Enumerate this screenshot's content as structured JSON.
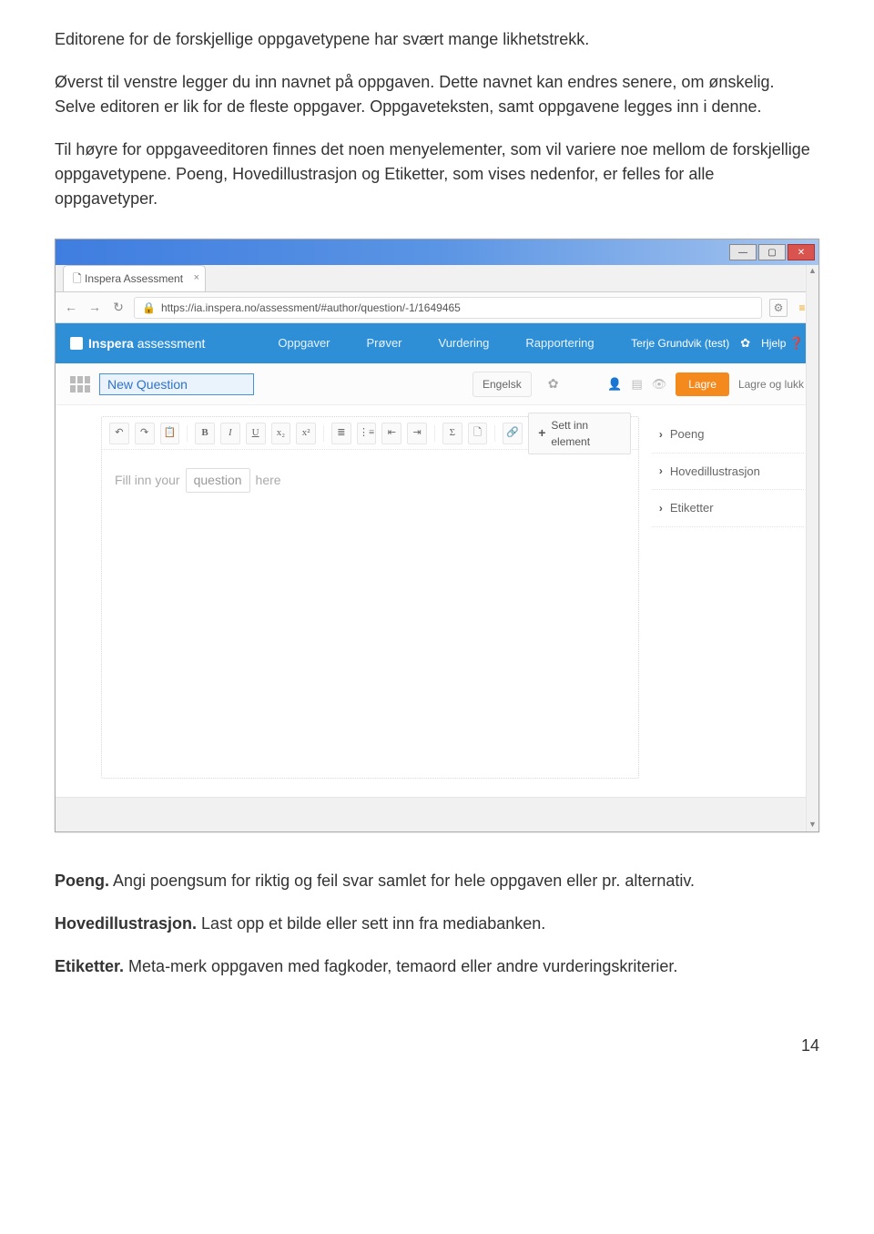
{
  "document": {
    "para1": "Editorene for de forskjellige oppgavetypene har svært mange likhetstrekk.",
    "para2": "Øverst til venstre legger du inn navnet på oppgaven. Dette navnet kan endres senere, om ønskelig. Selve editoren er lik for de fleste oppgaver. Oppgaveteksten, samt oppgavene legges inn i denne.",
    "para3": "Til høyre for oppgaveeditoren finnes det noen menyelementer, som vil variere noe mellom de forskjellige oppgavetypene. Poeng, Hovedillustrasjon og Etiketter, som vises nedenfor, er felles for alle oppgavetyper.",
    "poeng_lead": "Poeng.",
    "poeng_rest": " Angi poengsum for riktig og feil svar samlet for hele oppgaven eller pr. alternativ.",
    "hoved_lead": "Hovedillustrasjon.",
    "hoved_rest": " Last opp et bilde eller sett inn fra mediabanken.",
    "etik_lead": "Etiketter.",
    "etik_rest": " Meta-merk oppgaven med fagkoder, temaord eller andre vurderingskriterier.",
    "page_number": "14"
  },
  "browser": {
    "tab_title": "Inspera Assessment",
    "url": "https://ia.inspera.no/assessment/#author/question/-1/1649465"
  },
  "app": {
    "logo_bold": "Inspera",
    "logo_light": " assessment",
    "nav": [
      "Oppgaver",
      "Prøver",
      "Vurdering",
      "Rapportering"
    ],
    "user_name": "Terje Grundvik (test)",
    "help_label": "Hjelp"
  },
  "actionbar": {
    "title_value": "New Question",
    "language": "Engelsk",
    "save": "Lagre",
    "save_close": "Lagre og lukk"
  },
  "toolbar": {
    "buttons": [
      "↶",
      "↷",
      "📋",
      "B",
      "I",
      "U",
      "x₂",
      "x²",
      "≣",
      "⋮≡",
      "⇤",
      "⇥",
      "Σ",
      "🗋",
      "🔗"
    ],
    "insert_label": "Sett inn element"
  },
  "editor": {
    "fill_prefix": "Fill inn your",
    "fill_field": "question",
    "fill_suffix": "here"
  },
  "sidepanel": {
    "items": [
      "Poeng",
      "Hovedillustrasjon",
      "Etiketter"
    ]
  }
}
